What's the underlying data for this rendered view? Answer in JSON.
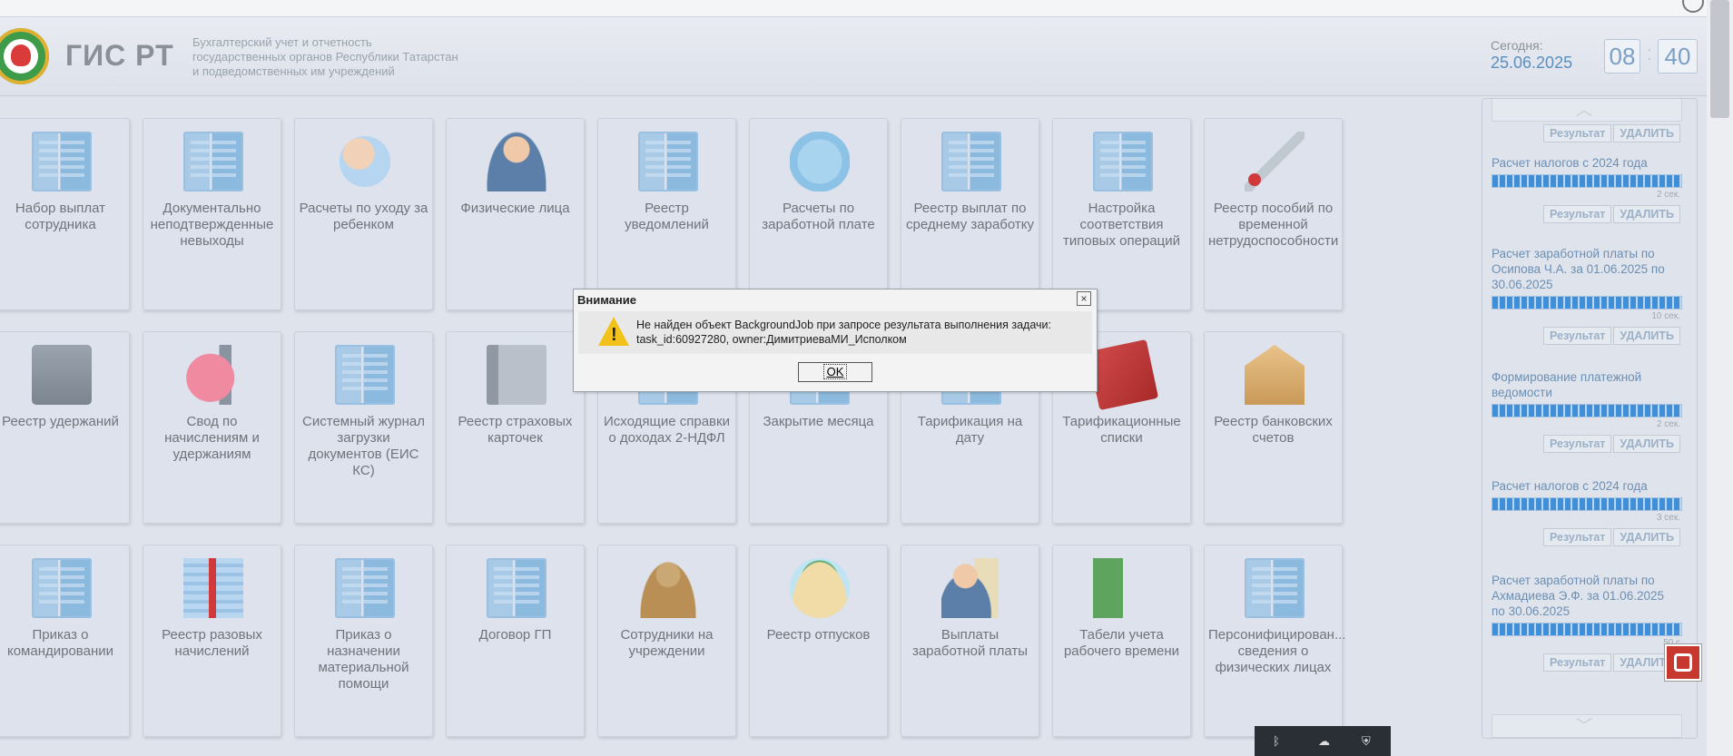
{
  "header": {
    "title": "ГИС РТ",
    "subtitle_lines": [
      "Бухгалтерский учет и отчетность",
      "государственных органов Республики Татарстан",
      "и подведомственных им учреждений"
    ],
    "today_label": "Сегодня:",
    "today_date": "25.06.2025",
    "clock_hours": "08",
    "clock_minutes": "40"
  },
  "tiles": [
    {
      "label": "Набор выплат сотрудника",
      "icon": "building-icon"
    },
    {
      "label": "Документально неподтвержденные невыходы",
      "icon": "building-icon"
    },
    {
      "label": "Расчеты по уходу за ребенком",
      "icon": "baby-icon"
    },
    {
      "label": "Физические лица",
      "icon": "person-icon"
    },
    {
      "label": "Реестр уведомлений",
      "icon": "building-icon"
    },
    {
      "label": "Расчеты по заработной плате",
      "icon": "badge-icon"
    },
    {
      "label": "Реестр выплат по среднему заработку",
      "icon": "building-icon"
    },
    {
      "label": "Настройка соответствия типовых операций",
      "icon": "building-icon"
    },
    {
      "label": "Реестр пособий по временной нетрудоспособности",
      "icon": "thermometer-icon"
    },
    {
      "label": "Реестр удержаний",
      "icon": "safe-icon"
    },
    {
      "label": "Свод по начислениям и удержаниям",
      "icon": "piggy-bank-icon"
    },
    {
      "label": "Системный журнал загрузки документов (ЕИС КС)",
      "icon": "building-icon"
    },
    {
      "label": "Реестр страховых карточек",
      "icon": "book-icon"
    },
    {
      "label": "Исходящие справки о доходах 2-НДФЛ",
      "icon": "building-icon"
    },
    {
      "label": "Закрытие месяца",
      "icon": "building-icon"
    },
    {
      "label": "Тарификация на дату",
      "icon": "building-icon"
    },
    {
      "label": "Тарификационные списки",
      "icon": "red-book-icon"
    },
    {
      "label": "Реестр банковских счетов",
      "icon": "bank-icon"
    },
    {
      "label": "Приказ о командировании",
      "icon": "building-icon"
    },
    {
      "label": "Реестр разовых начислений",
      "icon": "money-icon"
    },
    {
      "label": "Приказ о назначении материальной помощи",
      "icon": "building-icon"
    },
    {
      "label": "Договор ГП",
      "icon": "building-icon"
    },
    {
      "label": "Сотрудники на учреждении",
      "icon": "golden-person-icon"
    },
    {
      "label": "Реестр отпусков",
      "icon": "palm-icon"
    },
    {
      "label": "Выплаты заработной платы",
      "icon": "person-document-icon"
    },
    {
      "label": "Табели учета рабочего времени",
      "icon": "hourglass-icon"
    },
    {
      "label": "Персонифицирован... сведения о физических лицах",
      "icon": "building-icon"
    }
  ],
  "jobs_panel": {
    "result_label": "Результат",
    "delete_label": "УДАЛИТЬ",
    "jobs": [
      {
        "name": "Расчет налогов с 2024 года",
        "time": "2 сек.",
        "progress": 1.0
      },
      {
        "name": "Расчет заработной платы по Осипова Ч.А. за 01.06.2025 по 30.06.2025",
        "time": "10 сек.",
        "progress": 1.0
      },
      {
        "name": "Формирование платежной ведомости",
        "time": "2 сек.",
        "progress": 1.0
      },
      {
        "name": "Расчет налогов с 2024 года",
        "time": "3 сек.",
        "progress": 1.0
      },
      {
        "name": "Расчет заработной платы по Ахмадиева Э.Ф. за 01.06.2025 по 30.06.2025",
        "time": "50 с",
        "progress": 1.0
      }
    ]
  },
  "dialog": {
    "title": "Внимание",
    "message_line1": "Не найден объект BackgroundJob при запросе результата выполнения задачи:",
    "message_line2": "task_id:60927280, owner:ДимитриеваМИ_Исполком",
    "ok_label": "OK",
    "close_glyph": "×"
  },
  "colors": {
    "accent": "#3f8ed8",
    "tile_bg": "#dde2ec",
    "warning": "#f2c21b"
  }
}
